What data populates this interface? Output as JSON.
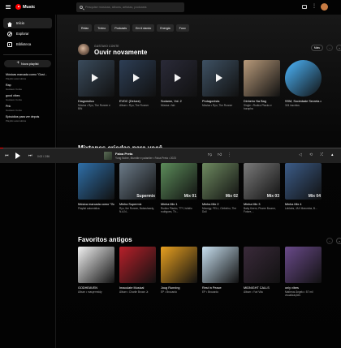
{
  "app": {
    "logo_text": "Music",
    "brand_color": "#ff0000"
  },
  "search": {
    "placeholder": "Pesquise músicas, álbuns, artistas, podcasts"
  },
  "sidebar": {
    "nav": [
      {
        "label": "Início",
        "icon": "home-icon"
      },
      {
        "label": "Explorar",
        "icon": "compass-icon"
      },
      {
        "label": "Biblioteca",
        "icon": "library-icon"
      }
    ],
    "new_playlist_label": "Nova playlist",
    "playlists": [
      {
        "title": "Músicas marcada como \"Gost...",
        "sub": "Playlist automática"
      },
      {
        "title": "Rap",
        "sub": "Gustavo Conte"
      },
      {
        "title": "good vibes",
        "sub": "Gustavo Conte"
      },
      {
        "title": "Pnk",
        "sub": "Gustavo Conte"
      },
      {
        "title": "Episódios para ver depois",
        "sub": "Playlist automática"
      }
    ]
  },
  "chips": [
    "Relax",
    "Treino",
    "Podcasts",
    "Em ti dando",
    "Energia",
    "Foco"
  ],
  "sections": {
    "listen_again": {
      "kicker": "GUSTAVO CONTE",
      "title": "Ouvir novamente",
      "more_label": "Mais",
      "cards": [
        {
          "title": "Diagnóstico",
          "sub": "Música • Ryu, The Runner e BIN",
          "color": "#3a4b5c"
        },
        {
          "title": "EVDC (Deluxe)",
          "sub": "Álbum • Ryu, The Runner",
          "color": "#2d3e55"
        },
        {
          "title": "Sodamn, Vol. 2",
          "sub": "Música • fab",
          "color": "#2a2a38"
        },
        {
          "title": "Protagonista",
          "sub": "Música • Ryu, The Runner",
          "color": "#3e5163"
        },
        {
          "title": "Dinheiro Na Bag",
          "sub": "Single • Rudico Placko e borapha",
          "color": "#b89a7a"
        },
        {
          "title": "SSM, Sociedade Secreta dos Magrão",
          "sub": "324 inscritos",
          "color": "#4db8ff"
        }
      ]
    },
    "mixes": {
      "title": "Mixtapes criadas para você",
      "cards": [
        {
          "title": "Música marcada como \"Gostei\"",
          "sub": "Playlist automática",
          "color": "#2f6fa8",
          "mix": ""
        },
        {
          "title": "Minha Supermix",
          "sub": "Ryu, the Runner, Babashawty, N.A.N...",
          "color": "#6b7a88",
          "mix": "Supermix"
        },
        {
          "title": "Minha Mix 1",
          "sub": "Rudico Placko, TTY, Ishidio rodrigues, Th...",
          "color": "#5c8c5a",
          "mix": "Mix 01"
        },
        {
          "title": "Minha Mix 2",
          "sub": "Mouegy, FELL, Clebinho, The Doll",
          "color": "#6e8a60",
          "mix": "Mix 02"
        },
        {
          "title": "Minha Mix 3",
          "sub": "Baby Keem, Pharre Bourne, Future,...",
          "color": "#7a7a7a",
          "mix": "Mix 03"
        },
        {
          "title": "Minha Mix 4",
          "sub": "Leblabs, JAX Maromba, B...",
          "color": "#3c5c88",
          "mix": "Mix 04"
        }
      ]
    },
    "favorites": {
      "title": "Favoritos antigos",
      "cards": [
        {
          "title": "GODHEAVEN",
          "sub": "Álbum • mavyrrreddy",
          "color": "#f2f2f2"
        },
        {
          "title": "Imaculate Musical",
          "sub": "Álbum • Charlie Brown Jr.",
          "color": "#b8202a"
        },
        {
          "title": "Joug Running",
          "sub": "EP • Brocardo",
          "color": "#e8a020"
        },
        {
          "title": "Rest in Peace",
          "sub": "EP • Brocardo",
          "color": "#c8e0f0"
        },
        {
          "title": "MIDNIGHT CALLS",
          "sub": "Álbum • Yuri Vita",
          "color": "#3a2a3a"
        },
        {
          "title": "only vibes",
          "sub": "Matheus Ângelo • 57 mil visualizações",
          "color": "#6a4a8a"
        }
      ]
    }
  },
  "player": {
    "title": "Faixa Preta",
    "meta": "Yung Nobre, Mumble e palantier • Faixa Preta • 2023",
    "time": "0:02 / 2:56",
    "progress": 0.01
  }
}
